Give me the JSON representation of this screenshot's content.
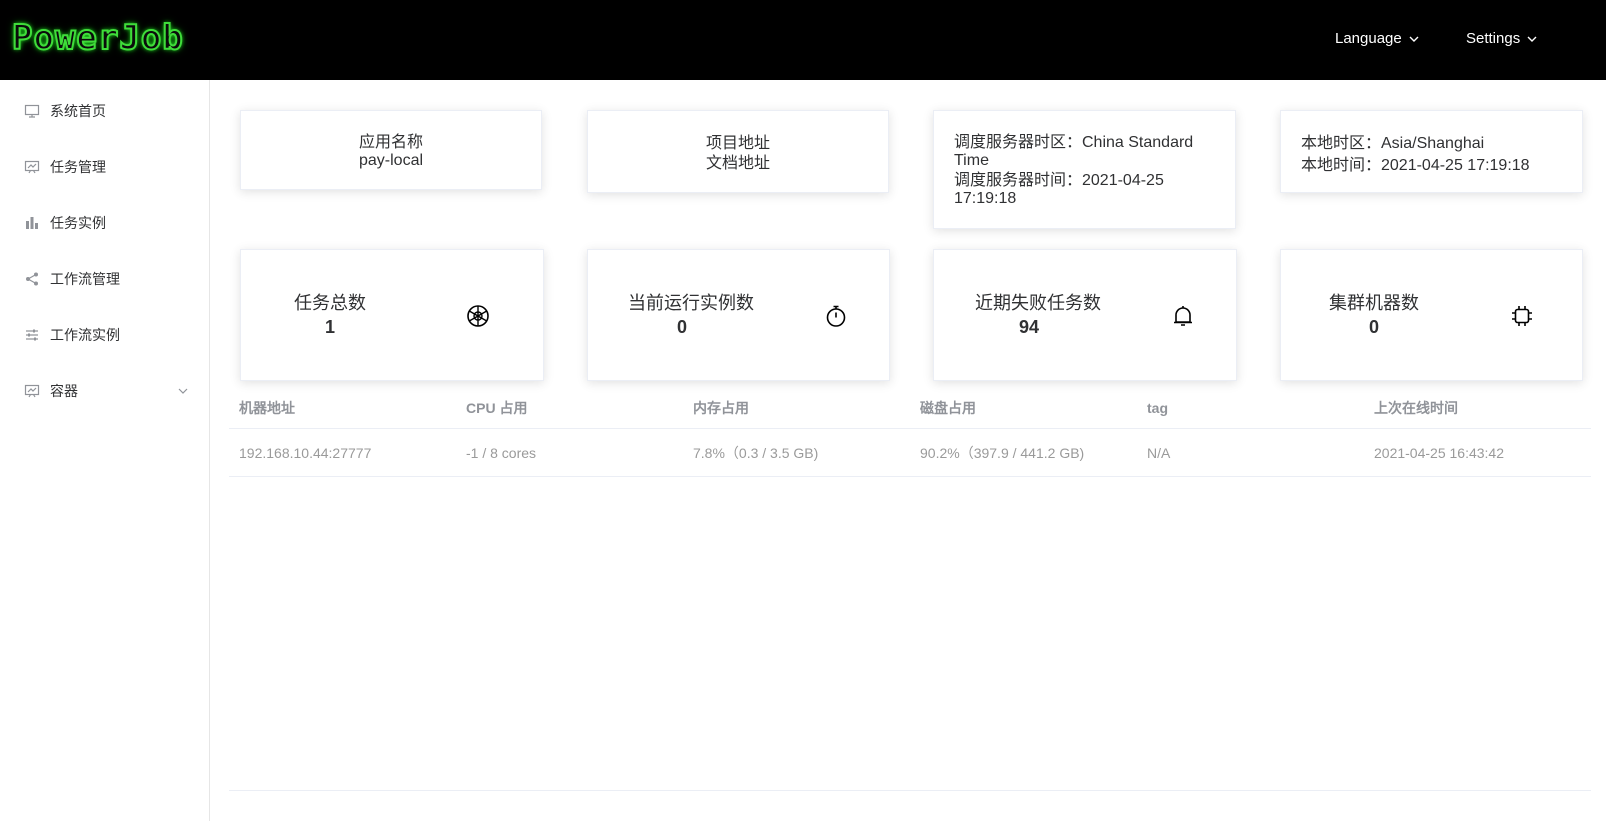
{
  "header": {
    "logo": "PowerJob",
    "language_label": "Language",
    "settings_label": "Settings"
  },
  "sidebar": {
    "items": [
      {
        "label": "系统首页",
        "icon": "monitor-icon"
      },
      {
        "label": "任务管理",
        "icon": "presentation-icon"
      },
      {
        "label": "任务实例",
        "icon": "bar-chart-icon"
      },
      {
        "label": "工作流管理",
        "icon": "share-icon"
      },
      {
        "label": "工作流实例",
        "icon": "sliders-icon"
      },
      {
        "label": "容器",
        "icon": "presentation-icon"
      }
    ]
  },
  "info_cards": {
    "app": {
      "line1": "应用名称",
      "line2": "pay-local"
    },
    "project": {
      "line1": "项目地址",
      "line2": "文档地址"
    },
    "server": {
      "timezone": "调度服务器时区：China Standard Time",
      "time": "调度服务器时间：2021-04-25 17:19:18"
    },
    "local": {
      "timezone": "本地时区：Asia/Shanghai",
      "time": "本地时间：2021-04-25 17:19:18"
    }
  },
  "stats": [
    {
      "title": "任务总数",
      "value": "1",
      "icon": "aperture-icon"
    },
    {
      "title": "当前运行实例数",
      "value": "0",
      "icon": "stopwatch-icon"
    },
    {
      "title": "近期失败任务数",
      "value": "94",
      "icon": "bell-icon"
    },
    {
      "title": "集群机器数",
      "value": "0",
      "icon": "cpu-icon"
    }
  ],
  "table": {
    "headers": [
      "机器地址",
      "CPU 占用",
      "内存占用",
      "磁盘占用",
      "tag",
      "上次在线时间"
    ],
    "rows": [
      [
        "192.168.10.44:27777",
        "-1 / 8 cores",
        "7.8%（0.3 / 3.5 GB)",
        "90.2%（397.9 / 441.2 GB)",
        "N/A",
        "2021-04-25 16:43:42"
      ]
    ]
  }
}
